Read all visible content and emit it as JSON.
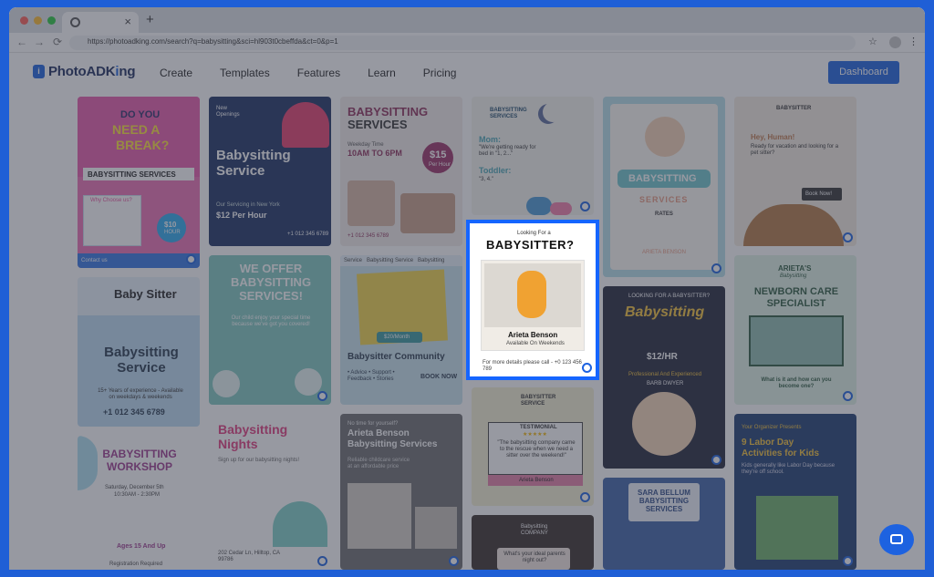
{
  "browser": {
    "url": "https://photoadking.com/search?q=babysitting&sci=hl903t0cbeffda&ct=0&p=1",
    "tab_close": "×",
    "new_tab": "+",
    "back": "←",
    "forward": "→",
    "reload": "⟳",
    "star": "☆",
    "menu": "⋮"
  },
  "header": {
    "logo_text": "PhotoADK",
    "logo_text2": "ng",
    "nav": [
      "Create",
      "Templates",
      "Features",
      "Learn",
      "Pricing"
    ],
    "dashboard_label": "Dashboard"
  },
  "cards": {
    "c1": {
      "title1": "DO YOU",
      "title2": "NEED A",
      "title3": "BREAK?",
      "banner": "BABYSITTING SERVICES",
      "sub": "Why Choose us?",
      "price": "$10",
      "unit": "HOUR",
      "contact": "Contact us"
    },
    "c2": {
      "tag": "New Openings",
      "title": "Babysitting Service",
      "sub": "Our Servicing in New York",
      "price": "$12 Per Hour",
      "phone": "+1 012 345 6789"
    },
    "c3": {
      "title1": "BABYSITTING",
      "title2": "SERVICES",
      "days": "Weekday Time",
      "hours": "10AM TO 6PM",
      "price": "$15",
      "unit": "Per Hour",
      "phone": "+1 012 345 6789"
    },
    "c4": {
      "logo": "BABYSITTING SERVICES",
      "mom": "Mom:",
      "mom_text": "\"We're getting ready for bed in \"1, 2...\"",
      "toddler": "Toddler:",
      "toddler_text": "\"3, 4.\""
    },
    "c5": {
      "title": "BABYSITTING",
      "sub": "SERVICES",
      "rates": "RATES",
      "name": "ARIETA BENSON"
    },
    "c6": {
      "logo": "BABYSITTER",
      "title": "Hey, Human!",
      "text": "Ready for vacation and looking for a pet sitter?",
      "cta": "Book Now!"
    },
    "c7": {
      "title": "WE OFFER BABYSITTING SERVICES!",
      "text": "Our child enjoy your special time because we've got you covered!"
    },
    "c8": {
      "tabs": "Service   Babysitting Service   Babysitting",
      "price": "$20/Month",
      "title": "Babysitter Community",
      "items": "• Advice  • Support  • Feedback  • Stories",
      "cta": "BOOK NOW"
    },
    "c9": {
      "pre": "Looking For a",
      "title": "BABYSITTER?",
      "name": "Arieta Benson",
      "sub": "Available On Weekends",
      "footer": "For more details please call - +0 123 456 789"
    },
    "c10": {
      "title": "LOOKING FOR A BABYSITTER?",
      "script": "Babysitting",
      "price": "$12/HR",
      "sub": "Professional And Experienced",
      "name": "BARB DWYER"
    },
    "c11": {
      "title": "ARIETA'S",
      "script": "Babysitting",
      "title2": "NEWBORN CARE SPECIALIST",
      "q": "What is it and how can you become one?"
    },
    "c12": {
      "title": "Baby Sitter",
      "main": "Babysitting Service",
      "sub": "15+ Years of experience - Available on weekdays & weekends",
      "phone": "+1 012 345 6789"
    },
    "c13": {
      "title": "Babysitting Nights",
      "text": "Sign up for our babysitting nights!",
      "phone": "202 Cedar Ln, Hilltop, CA 99786"
    },
    "c14": {
      "pre": "No time for yourself?",
      "title": "Arieta Benson Babysitting Services",
      "sub": "Reliable childcare service at an affordable price"
    },
    "c15": {
      "logo": "BABYSITTER SERVICE",
      "label": "TESTIMONIAL",
      "stars": "★★★★★",
      "quote": "\"The babysitting company came to the rescue when we need a sitter over the weekend!\"",
      "name": "Arieta Benson"
    },
    "c16": {
      "title": "BABYSITTING WORKSHOP",
      "date": "Saturday, December 5th",
      "time": "10:30AM - 2:30PM",
      "ages": "Ages 15 And Up",
      "reg": "Registration Required"
    },
    "c17": {
      "logo": "Babysitting COMPANY",
      "q": "What's your ideal parents night out?"
    },
    "c18": {
      "title": "SARA BELLUM BABYSITTING SERVICES"
    },
    "c19": {
      "pre": "Your Organizer Presents",
      "title": "9 Labor Day Activities for Kids",
      "text": "Kids generally like Labor Day because they're off school."
    }
  },
  "colors": {
    "frame": "#1f5fd6",
    "accent": "#1d62e0",
    "highlight_border": "#1565ff"
  }
}
